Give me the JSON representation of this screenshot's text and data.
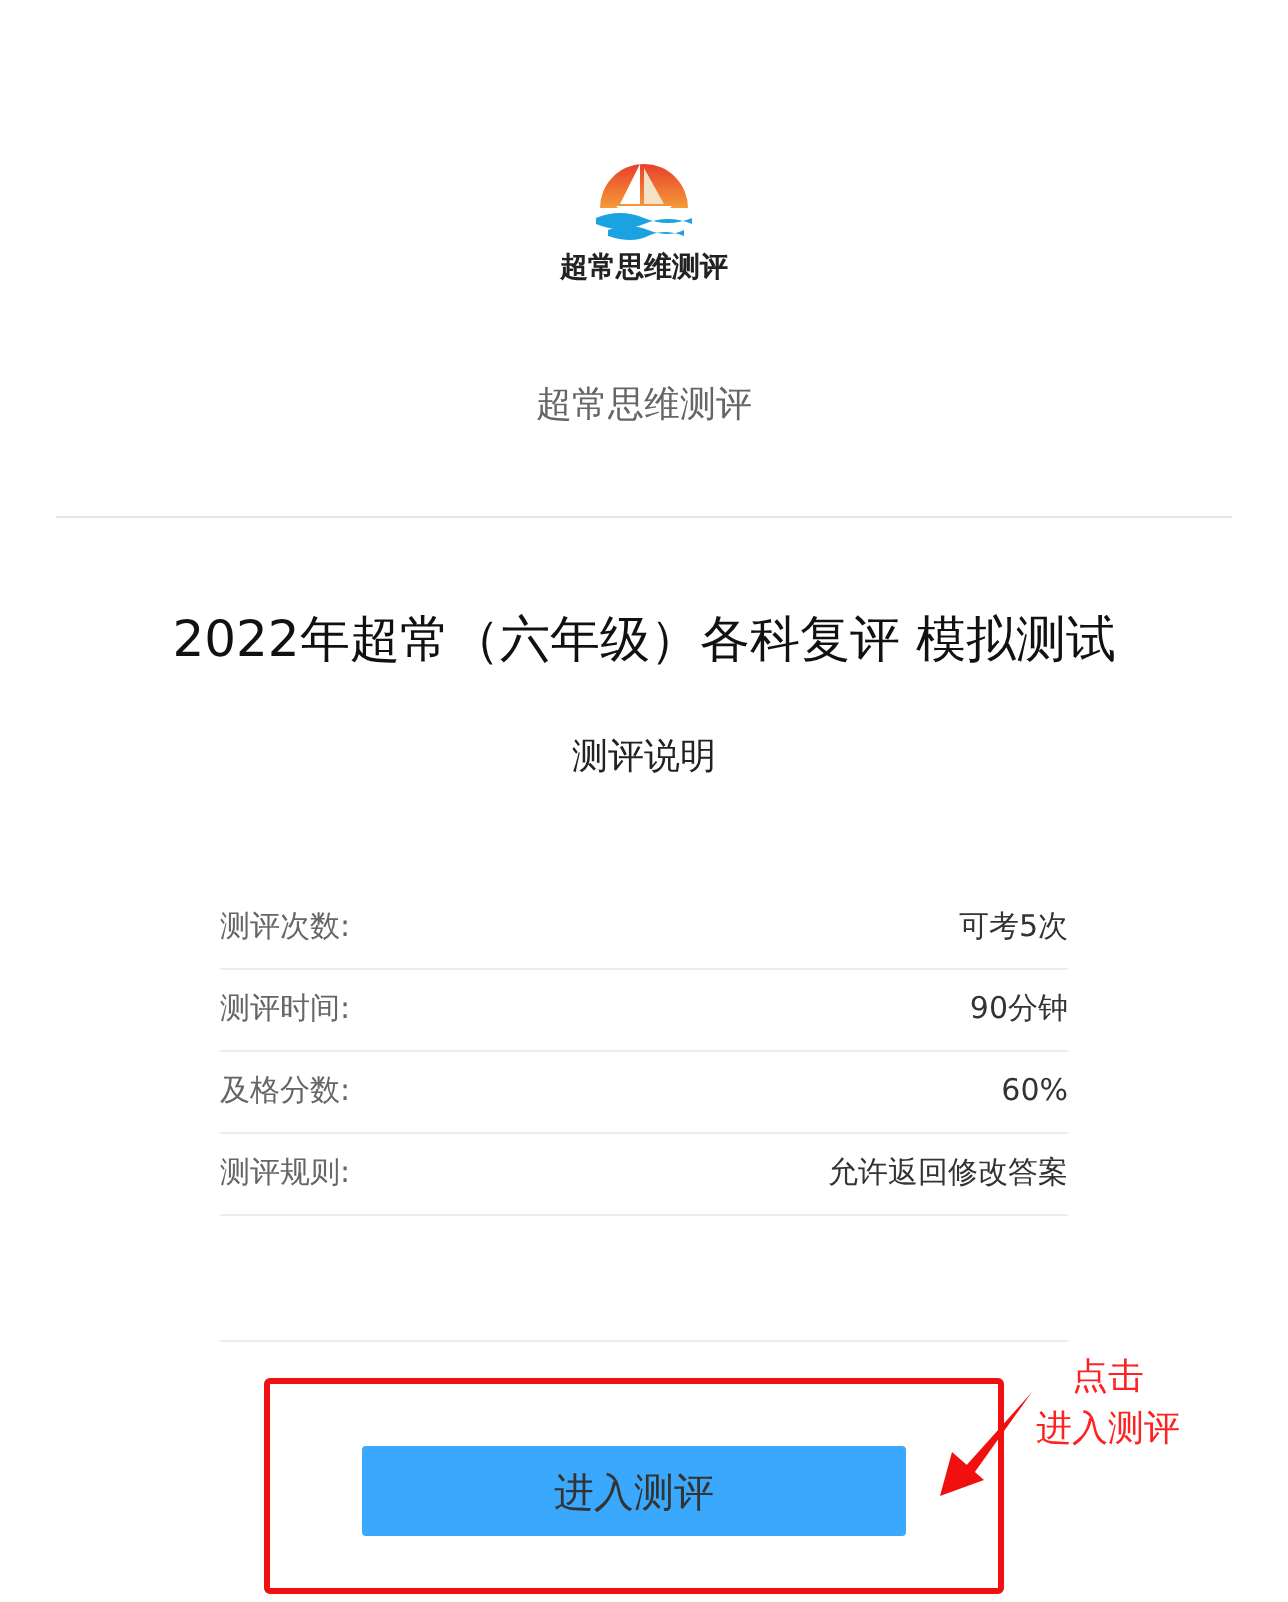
{
  "logo": {
    "caption": "超常思维测评"
  },
  "site_name": "超常思维测评",
  "title": "2022年超常（六年级）各科复评 模拟测试",
  "subtitle": "测评说明",
  "info_rows": [
    {
      "label": "测评次数:",
      "value": "可考5次"
    },
    {
      "label": "测评时间:",
      "value": "90分钟"
    },
    {
      "label": "及格分数:",
      "value": "60%"
    },
    {
      "label": "测评规则:",
      "value": "允许返回修改答案"
    }
  ],
  "start_button": {
    "label": "进入测评"
  },
  "annotation": {
    "lines": [
      "点击",
      "进入测评"
    ]
  }
}
